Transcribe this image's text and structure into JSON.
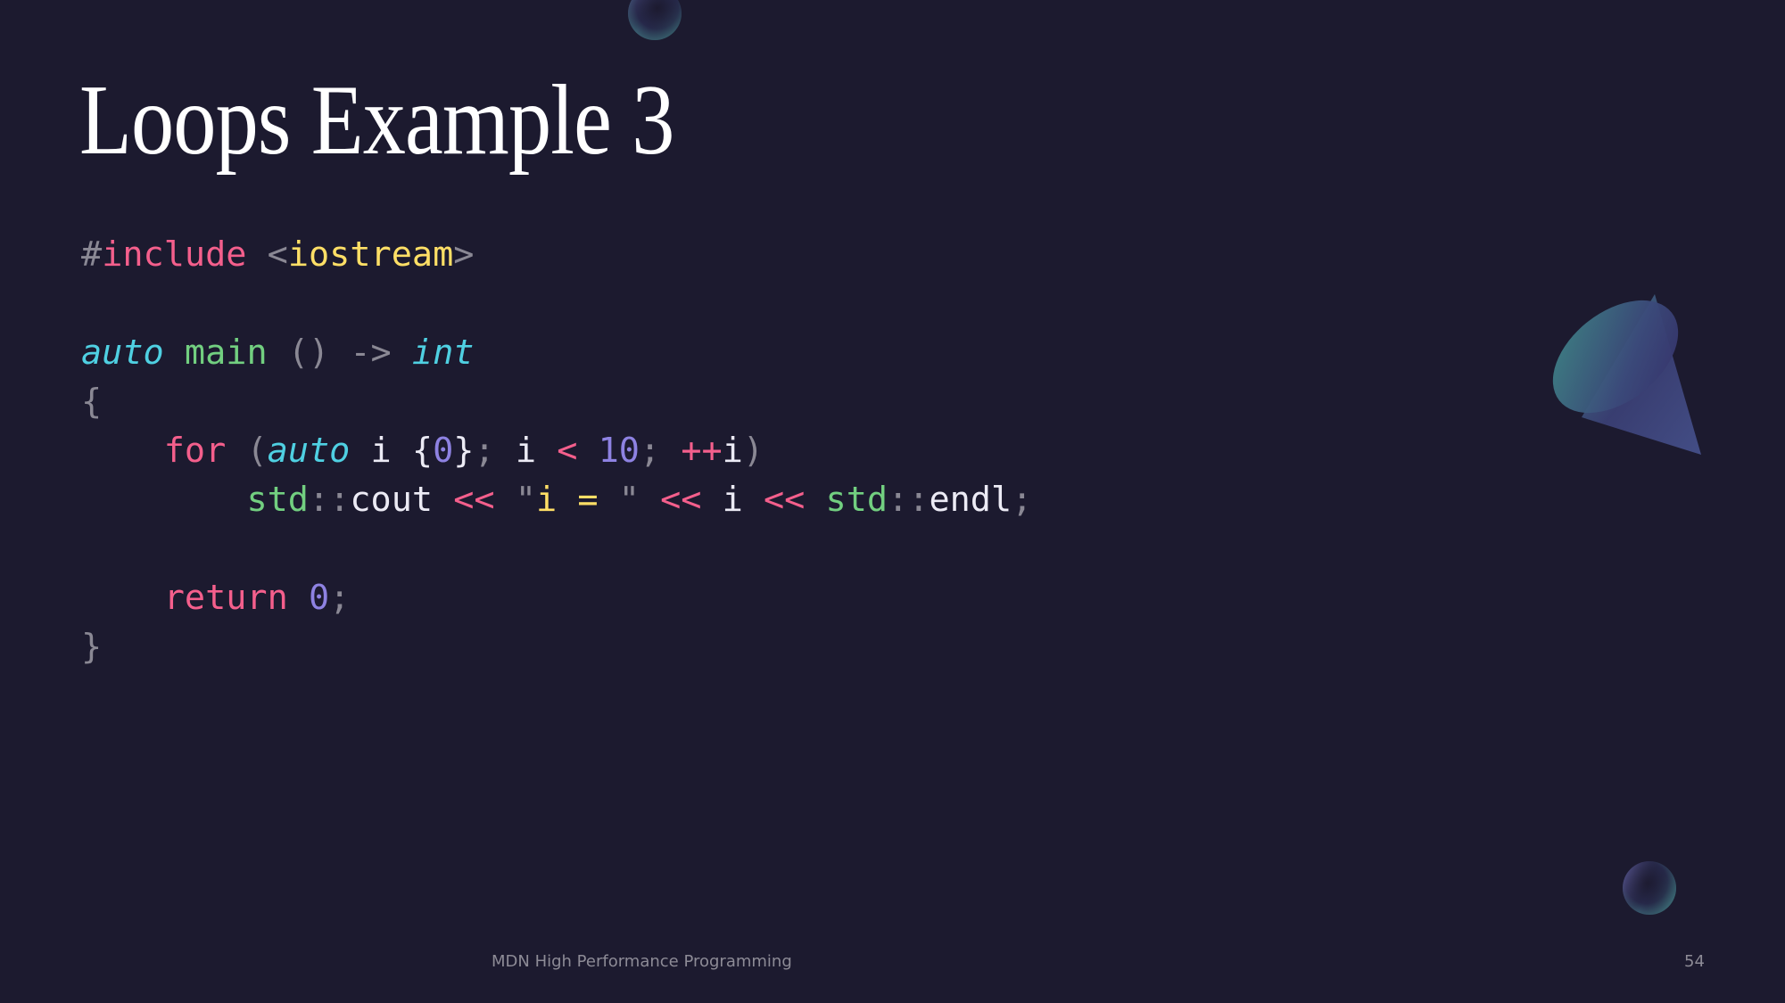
{
  "slide": {
    "title": "Loops Example 3",
    "footer": "MDN High Performance Programming",
    "page_number": "54",
    "background_color": "#1c1a2f"
  },
  "code": {
    "language": "cpp",
    "lines": [
      [
        {
          "t": "#",
          "k": "punc"
        },
        {
          "t": "include",
          "k": "kw"
        },
        {
          "t": " ",
          "k": "id"
        },
        {
          "t": "<",
          "k": "punc"
        },
        {
          "t": "iostream",
          "k": "str"
        },
        {
          "t": ">",
          "k": "punc"
        }
      ],
      [],
      [
        {
          "t": "auto",
          "k": "type"
        },
        {
          "t": " ",
          "k": "id"
        },
        {
          "t": "main",
          "k": "fn"
        },
        {
          "t": " ",
          "k": "id"
        },
        {
          "t": "()",
          "k": "punc"
        },
        {
          "t": " ",
          "k": "id"
        },
        {
          "t": "->",
          "k": "punc"
        },
        {
          "t": " ",
          "k": "id"
        },
        {
          "t": "int",
          "k": "type"
        }
      ],
      [
        {
          "t": "{",
          "k": "punc"
        }
      ],
      [
        {
          "t": "    ",
          "k": "id"
        },
        {
          "t": "for",
          "k": "kw"
        },
        {
          "t": " ",
          "k": "id"
        },
        {
          "t": "(",
          "k": "punc"
        },
        {
          "t": "auto",
          "k": "type"
        },
        {
          "t": " i ",
          "k": "id"
        },
        {
          "t": "{",
          "k": "id"
        },
        {
          "t": "0",
          "k": "num"
        },
        {
          "t": "}",
          "k": "id"
        },
        {
          "t": ";",
          "k": "punc"
        },
        {
          "t": " i ",
          "k": "id"
        },
        {
          "t": "<",
          "k": "kw"
        },
        {
          "t": " ",
          "k": "id"
        },
        {
          "t": "10",
          "k": "num"
        },
        {
          "t": ";",
          "k": "punc"
        },
        {
          "t": " ",
          "k": "id"
        },
        {
          "t": "++",
          "k": "kw"
        },
        {
          "t": "i",
          "k": "id"
        },
        {
          "t": ")",
          "k": "punc"
        }
      ],
      [
        {
          "t": "        ",
          "k": "id"
        },
        {
          "t": "std",
          "k": "fn"
        },
        {
          "t": "::",
          "k": "punc"
        },
        {
          "t": "cout",
          "k": "id"
        },
        {
          "t": " ",
          "k": "id"
        },
        {
          "t": "<<",
          "k": "kw"
        },
        {
          "t": " ",
          "k": "id"
        },
        {
          "t": "\"",
          "k": "punc"
        },
        {
          "t": "i = ",
          "k": "str"
        },
        {
          "t": "\"",
          "k": "punc"
        },
        {
          "t": " ",
          "k": "id"
        },
        {
          "t": "<<",
          "k": "kw"
        },
        {
          "t": " i ",
          "k": "id"
        },
        {
          "t": "<<",
          "k": "kw"
        },
        {
          "t": " ",
          "k": "id"
        },
        {
          "t": "std",
          "k": "fn"
        },
        {
          "t": "::",
          "k": "punc"
        },
        {
          "t": "endl",
          "k": "id"
        },
        {
          "t": ";",
          "k": "punc"
        }
      ],
      [],
      [
        {
          "t": "    ",
          "k": "id"
        },
        {
          "t": "return",
          "k": "kw"
        },
        {
          "t": " ",
          "k": "id"
        },
        {
          "t": "0",
          "k": "num"
        },
        {
          "t": ";",
          "k": "punc"
        }
      ],
      [
        {
          "t": "}",
          "k": "punc"
        }
      ]
    ]
  },
  "decorations": [
    "sphere-top",
    "cone-right",
    "sphere-bottom-right"
  ]
}
